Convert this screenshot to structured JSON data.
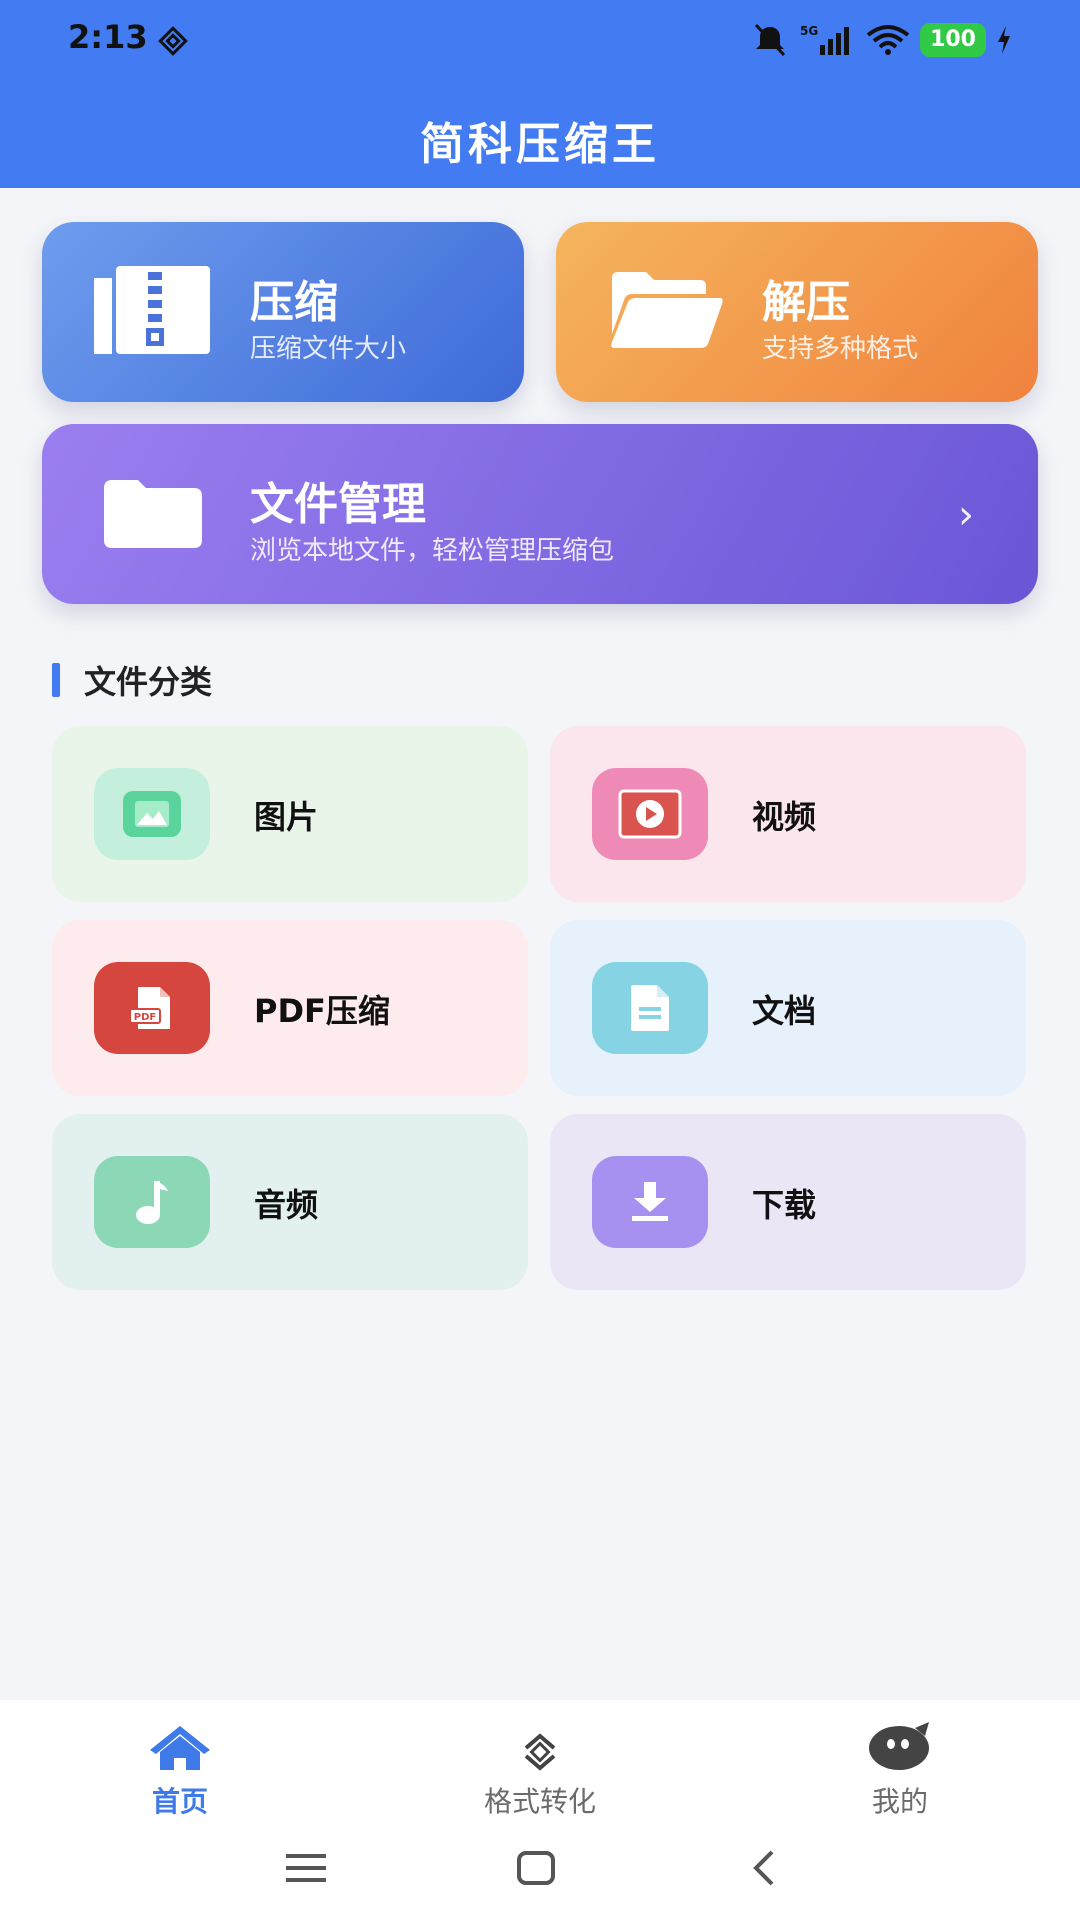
{
  "status_bar": {
    "time": "2:13",
    "network": "5G",
    "battery": "100"
  },
  "header": {
    "title": "简科压缩王"
  },
  "actions": {
    "compress": {
      "title": "压缩",
      "subtitle": "压缩文件大小",
      "icon": "zip-archive-icon"
    },
    "extract": {
      "title": "解压",
      "subtitle": "支持多种格式",
      "icon": "open-folder-icon"
    },
    "files": {
      "title": "文件管理",
      "subtitle": "浏览本地文件，轻松管理压缩包",
      "icon": "folder-icon",
      "chevron": "›"
    }
  },
  "categories": {
    "heading": "文件分类",
    "items": [
      {
        "label": "图片",
        "icon": "image-icon",
        "bg": "#eaf5ea",
        "icon_bg": "#c3efdc"
      },
      {
        "label": "视频",
        "icon": "video-icon",
        "bg": "#fbe6ee",
        "icon_bg": "#ee8ab5"
      },
      {
        "label": "PDF压缩",
        "icon": "pdf-icon",
        "bg": "#fdebee",
        "icon_bg": "#d4463e"
      },
      {
        "label": "文档",
        "icon": "document-icon",
        "bg": "#e6f1fc",
        "icon_bg": "#86d4e3"
      },
      {
        "label": "音频",
        "icon": "music-icon",
        "bg": "#e2f1f0",
        "icon_bg": "#8cd8b6"
      },
      {
        "label": "下载",
        "icon": "download-icon",
        "bg": "#ebe6f6",
        "icon_bg": "#a691f0"
      }
    ]
  },
  "bottom_nav": {
    "items": [
      {
        "label": "首页",
        "icon": "home-icon",
        "active": true
      },
      {
        "label": "格式转化",
        "icon": "convert-icon",
        "active": false
      },
      {
        "label": "我的",
        "icon": "profile-icon",
        "active": false
      }
    ]
  },
  "colors": {
    "primary": "#437cf2",
    "active_nav": "#3f7ae9"
  }
}
